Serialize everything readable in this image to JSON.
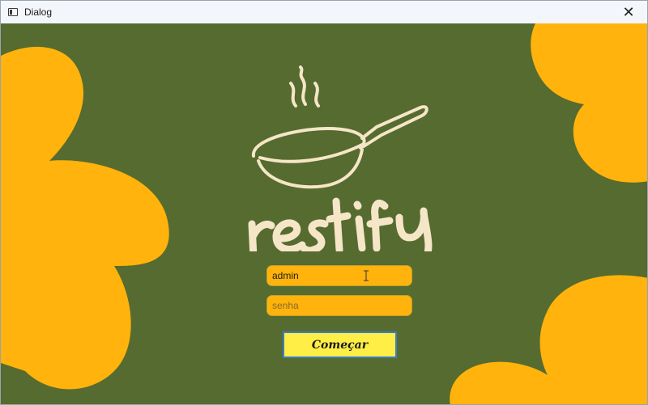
{
  "window": {
    "title": "Dialog",
    "close_glyph": "✕",
    "icon": "window-icon"
  },
  "brand": {
    "name": "restify",
    "logo_icon": "frying-pan-icon"
  },
  "login": {
    "username_value": "admin",
    "password_placeholder": "senha",
    "start_label": "Começar"
  },
  "colors": {
    "background": "#566b2f",
    "blob": "#ffb30c",
    "logo": "#f5e6c8",
    "button": "#ffee45",
    "button_border": "#3e7cc4"
  }
}
